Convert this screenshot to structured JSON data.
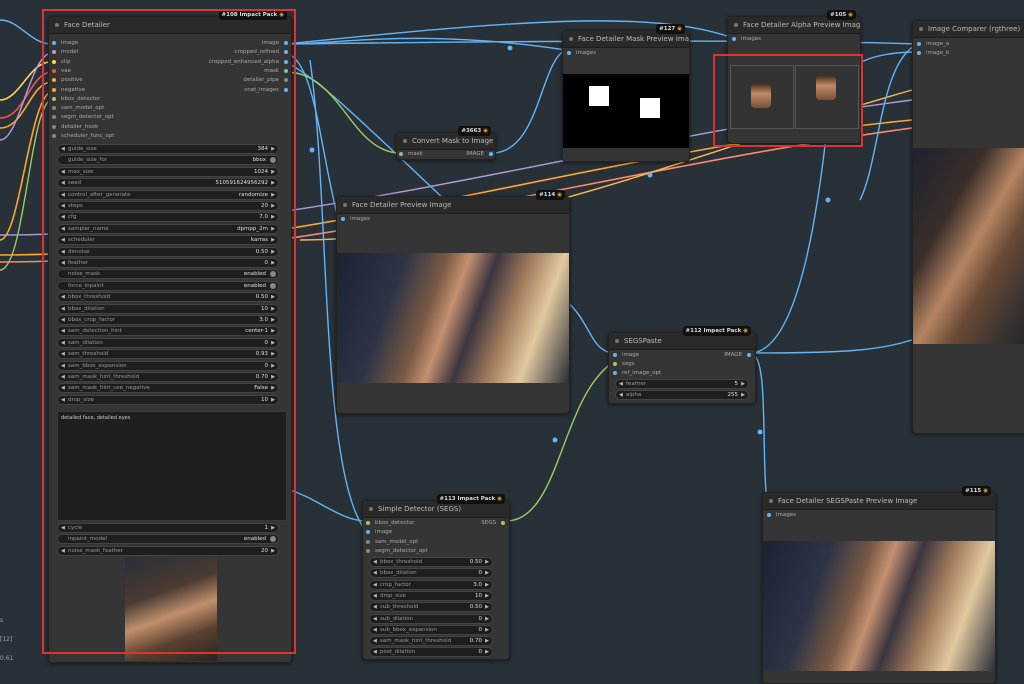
{
  "colors": {
    "canvas": "#283138",
    "node": "#353535",
    "accent_red": "#dd3333",
    "image_port": "#64b5f6",
    "mask_port": "#81c784",
    "model_port": "#b39ddb",
    "clip_port": "#ffd54f",
    "vae_port": "#ef5350",
    "cond_port": "#ffa726",
    "segs_port": "#9ccc65"
  },
  "face_detailer": {
    "badge": "#108 Impact Pack",
    "title": "Face Detailer",
    "inputs": [
      "image",
      "model",
      "clip",
      "vae",
      "positive",
      "negative",
      "bbox_detector",
      "sam_model_opt",
      "segm_detector_opt",
      "detailer_hook",
      "scheduler_func_opt"
    ],
    "outputs": [
      "image",
      "cropped_refined",
      "cropped_enhanced_alpha",
      "mask",
      "detailer_pipe",
      "cnet_images"
    ],
    "widgets": [
      {
        "label": "guide_size",
        "value": "384"
      },
      {
        "label": "guide_size_for",
        "value": "bbox",
        "toggle": true
      },
      {
        "label": "max_size",
        "value": "1024"
      },
      {
        "label": "seed",
        "value": "510591624956292"
      },
      {
        "label": "control_after_generate",
        "value": "randomize"
      },
      {
        "label": "steps",
        "value": "20"
      },
      {
        "label": "cfg",
        "value": "7.0"
      },
      {
        "label": "sampler_name",
        "value": "dpmpp_2m"
      },
      {
        "label": "scheduler",
        "value": "karras"
      },
      {
        "label": "denoise",
        "value": "0.50"
      },
      {
        "label": "feather",
        "value": "0"
      },
      {
        "label": "noise_mask",
        "value": "enabled",
        "toggle": true
      },
      {
        "label": "force_inpaint",
        "value": "enabled",
        "toggle": true
      },
      {
        "label": "bbox_threshold",
        "value": "0.50"
      },
      {
        "label": "bbox_dilation",
        "value": "10"
      },
      {
        "label": "bbox_crop_factor",
        "value": "3.0"
      },
      {
        "label": "sam_detection_hint",
        "value": "center-1"
      },
      {
        "label": "sam_dilation",
        "value": "0"
      },
      {
        "label": "sam_threshold",
        "value": "0.93"
      },
      {
        "label": "sam_bbox_expansion",
        "value": "0"
      },
      {
        "label": "sam_mask_hint_threshold",
        "value": "0.70"
      },
      {
        "label": "sam_mask_hint_use_negative",
        "value": "False"
      },
      {
        "label": "drop_size",
        "value": "10"
      }
    ],
    "wildcard": "detailed face, detailed eyes",
    "widgets2": [
      {
        "label": "cycle",
        "value": "1"
      },
      {
        "label": "inpaint_model",
        "value": "enabled",
        "toggle": true
      },
      {
        "label": "noise_mask_feather",
        "value": "20"
      }
    ]
  },
  "mask_preview": {
    "badge": "#127",
    "title": "Face Detailer Mask Preview Image",
    "input": "images"
  },
  "alpha_preview": {
    "badge": "#105",
    "title": "Face Detailer Alpha Preview Image",
    "input": "images"
  },
  "comparer": {
    "title": "Image Comparer (rgthree)",
    "inputs": [
      "image_a",
      "image_b"
    ]
  },
  "convert_mask": {
    "badge": "#3663",
    "title": "Convert Mask to Image",
    "input": "mask",
    "output": "IMAGE"
  },
  "fd_preview": {
    "badge": "#114",
    "title": "Face Detailer Preview Image",
    "input": "images"
  },
  "segs_paste": {
    "badge": "#112 Impact Pack",
    "title": "SEGSPaste",
    "inputs": [
      "image",
      "segs",
      "ref_image_opt"
    ],
    "output": "IMAGE",
    "widgets": [
      {
        "label": "feather",
        "value": "5"
      },
      {
        "label": "alpha",
        "value": "255"
      }
    ]
  },
  "simple_detector": {
    "badge": "#113 Impact Pack",
    "title": "Simple Detector (SEGS)",
    "inputs": [
      "bbox_detector",
      "image",
      "sam_model_opt",
      "segm_detector_opt"
    ],
    "output": "SEGS",
    "widgets": [
      {
        "label": "bbox_threshold",
        "value": "0.50"
      },
      {
        "label": "bbox_dilation",
        "value": "0"
      },
      {
        "label": "crop_factor",
        "value": "3.0"
      },
      {
        "label": "drop_size",
        "value": "10"
      },
      {
        "label": "sub_threshold",
        "value": "0.50"
      },
      {
        "label": "sub_dilation",
        "value": "0"
      },
      {
        "label": "sub_bbox_expansion",
        "value": "0"
      },
      {
        "label": "sam_mask_hint_threshold",
        "value": "0.70"
      },
      {
        "label": "post_dilation",
        "value": "0"
      }
    ]
  },
  "segs_preview": {
    "badge": "#115",
    "title": "Face Detailer SEGSPaste Preview Image",
    "input": "images"
  },
  "corner": {
    "l1": "s",
    "l2": "[12]",
    "l3": "0.61"
  }
}
